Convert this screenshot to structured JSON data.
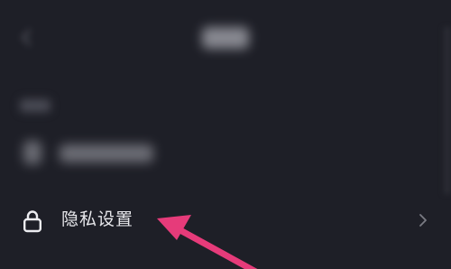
{
  "settings_list": {
    "privacy_row": {
      "label": "隐私设置",
      "icon": "lock-icon",
      "trailing_icon": "chevron-right-icon"
    }
  },
  "colors": {
    "background": "#1e1f27",
    "row_text": "#e8e8ec",
    "annotation_arrow": "#e63b7a"
  }
}
